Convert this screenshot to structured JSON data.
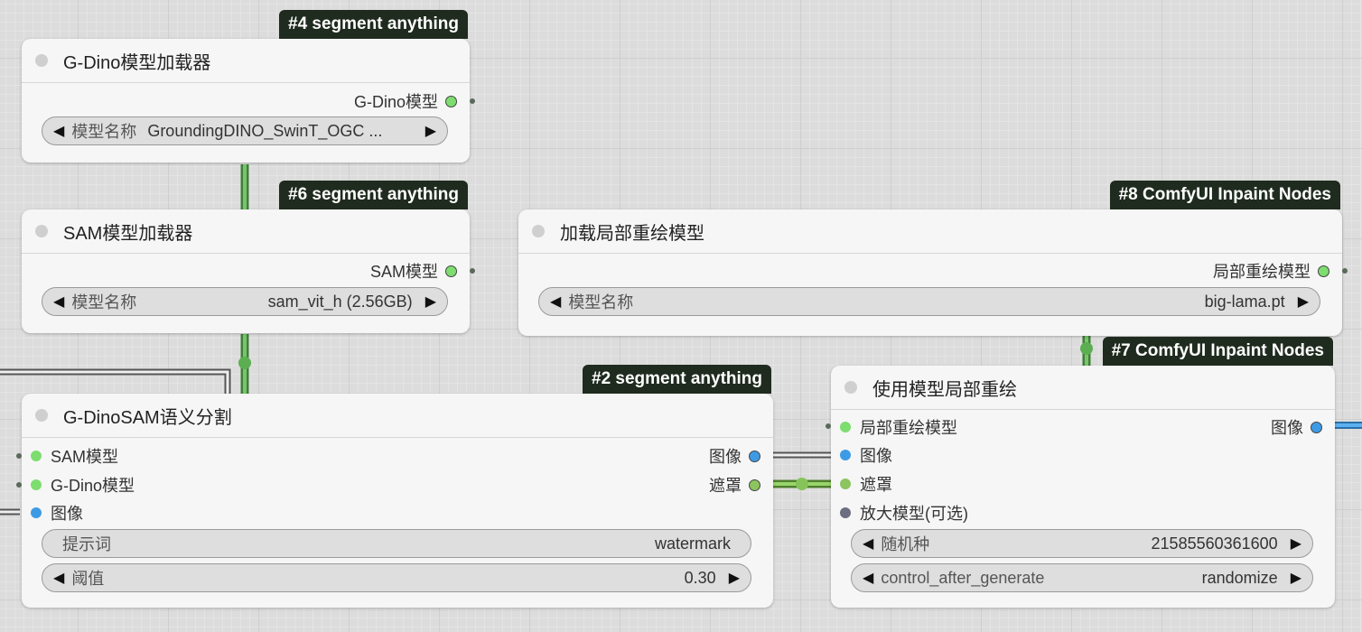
{
  "colors": {
    "model_socket": "#7ddd6f",
    "image_socket": "#3d9be6",
    "mask_socket": "#8cc460",
    "upscale_socket": "#6c6f80",
    "badge_bg": "#1f2b1e"
  },
  "nodes": {
    "gdino_loader": {
      "badge": "#4 segment anything",
      "title": "G-Dino模型加载器",
      "output": "G-Dino模型",
      "widget": {
        "label": "模型名称",
        "value": "GroundingDINO_SwinT_OGC ..."
      }
    },
    "sam_loader": {
      "badge": "#6 segment anything",
      "title": "SAM模型加载器",
      "output": "SAM模型",
      "widget": {
        "label": "模型名称",
        "value": "sam_vit_h (2.56GB)"
      }
    },
    "inpaint_loader": {
      "badge": "#8 ComfyUI Inpaint Nodes",
      "title": "加载局部重绘模型",
      "output": "局部重绘模型",
      "widget": {
        "label": "模型名称",
        "value": "big-lama.pt"
      }
    },
    "gdinosam_segment": {
      "badge": "#2 segment anything",
      "title": "G-DinoSAM语义分割",
      "inputs": [
        "SAM模型",
        "G-Dino模型",
        "图像"
      ],
      "outputs": [
        "图像",
        "遮罩"
      ],
      "prompt": {
        "label": "提示词",
        "value": "watermark"
      },
      "threshold": {
        "label": "阈值",
        "value": "0.30"
      }
    },
    "inpaint_with_model": {
      "badge": "#7 ComfyUI Inpaint Nodes",
      "title": "使用模型局部重绘",
      "inputs": [
        "局部重绘模型",
        "图像",
        "遮罩",
        "放大模型(可选)"
      ],
      "output": "图像",
      "seed": {
        "label": "随机种",
        "value": "21585560361600"
      },
      "control": {
        "label": "control_after_generate",
        "value": "randomize"
      }
    }
  },
  "icons": {
    "left_arrow": "◀",
    "right_arrow": "▶"
  }
}
